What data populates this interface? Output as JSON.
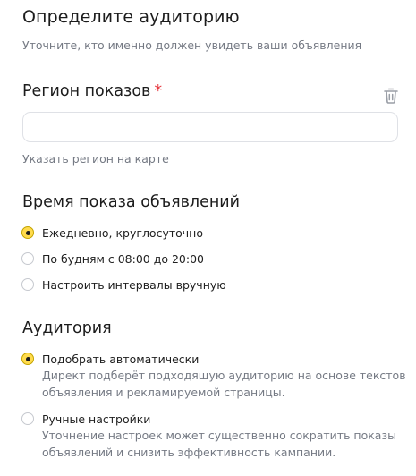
{
  "header": {
    "title": "Определите аудиторию",
    "subtitle": "Уточните, кто именно должен увидеть ваши объявления"
  },
  "region": {
    "title": "Регион показов",
    "required_mark": "*",
    "input_value": "",
    "input_placeholder": "",
    "map_link": "Указать регион на карте"
  },
  "schedule": {
    "title": "Время показа объявлений",
    "options": [
      {
        "label": "Ежедневно, круглосуточно",
        "selected": true
      },
      {
        "label": "По будням с 08:00 до 20:00",
        "selected": false
      },
      {
        "label": "Настроить интервалы вручную",
        "selected": false
      }
    ]
  },
  "audience": {
    "title": "Аудитория",
    "options": [
      {
        "label": "Подобрать автоматически",
        "selected": true,
        "description_line1": "Директ подберёт подходящую аудиторию на основе текстов",
        "description_line2": "объявления и рекламируемой страницы."
      },
      {
        "label": "Ручные настройки",
        "selected": false,
        "description_line1": "Уточнение настроек может существенно сократить показы",
        "description_line2": "объявлений и снизить эффективность кампании."
      }
    ]
  },
  "colors": {
    "radio_selected": "#ffdb4d",
    "required_asterisk": "#e5343b",
    "secondary_text": "#757a84",
    "input_border": "#dfe1e6"
  }
}
